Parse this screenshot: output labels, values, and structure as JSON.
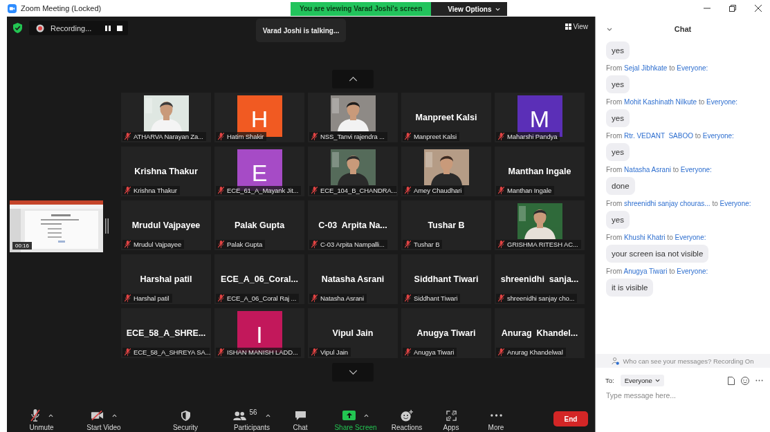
{
  "window": {
    "title": "Zoom Meeting (Locked)"
  },
  "banner": {
    "text": "You are viewing Varad Joshi's screen",
    "menu": "View Options"
  },
  "recording": {
    "label": "Recording..."
  },
  "talking": "Varad Joshi is talking...",
  "view_button": "View",
  "thumbnail": {
    "timer": "00:16"
  },
  "tiles": [
    {
      "label": "ATHARVA Narayan Za...",
      "muted": true
    },
    {
      "kind": "avatar",
      "letter": "H",
      "color": "#f15a22",
      "label": "Hatim Shakir",
      "muted": true
    },
    {
      "label": "NSS_Tanvi rajendra ...",
      "muted": true
    },
    {
      "kind": "name",
      "name": "Manpreet Kalsi",
      "label": "Manpreet Kalsi",
      "muted": true
    },
    {
      "kind": "avatar",
      "letter": "M",
      "color": "#5b2fb7",
      "label": "Maharshi Pandya",
      "muted": true
    },
    {
      "kind": "name",
      "name": "Krishna Thakur",
      "label": "Krishna Thakur",
      "muted": true
    },
    {
      "kind": "avatar",
      "letter": "E",
      "color": "#a64bc6",
      "label": "ECE_61_A_Mayank Jit...",
      "muted": true
    },
    {
      "label": "ECE_104_B_CHANDRA...",
      "muted": true
    },
    {
      "label": "Amey Chaudhari",
      "muted": true
    },
    {
      "kind": "name",
      "name": "Manthan Ingale",
      "label": "Manthan Ingale",
      "muted": true
    },
    {
      "kind": "name",
      "name": "Mrudul Vajpayee",
      "label": "Mrudul Vajpayee",
      "muted": true
    },
    {
      "kind": "name",
      "name": "Palak Gupta",
      "label": "Palak Gupta",
      "muted": true
    },
    {
      "kind": "name",
      "name": "C-03  Arpita Na...",
      "label": "C-03 Arpita Nampalli...",
      "muted": true
    },
    {
      "kind": "name",
      "name": "Tushar B",
      "label": "Tushar B",
      "muted": true
    },
    {
      "label": "GRISHMA RITESH AC...",
      "muted": true
    },
    {
      "kind": "name",
      "name": "Harshal patil",
      "label": "Harshal patil",
      "muted": true
    },
    {
      "kind": "name",
      "name": "ECE_A_06_Coral...",
      "label": "ECE_A_06_Coral Raj ...",
      "muted": true
    },
    {
      "kind": "name",
      "name": "Natasha Asrani",
      "label": "Natasha Asrani",
      "muted": true
    },
    {
      "kind": "name",
      "name": "Siddhant Tiwari",
      "label": "Siddhant Tiwari",
      "muted": true
    },
    {
      "kind": "name",
      "name": "shreenidhi  sanja...",
      "label": "shreenidhi sanjay cho...",
      "muted": true
    },
    {
      "kind": "name",
      "name": "ECE_58_A_SHRE...",
      "label": "ECE_58_A_SHREYA SA...",
      "muted": true
    },
    {
      "kind": "avatar",
      "letter": "I",
      "color": "#c2185b",
      "label": "ISHAN MANISH LADD...",
      "muted": true
    },
    {
      "kind": "name",
      "name": "Vipul Jain",
      "label": "Vipul Jain",
      "muted": true
    },
    {
      "kind": "name",
      "name": "Anugya Tiwari",
      "label": "Anugya Tiwari",
      "muted": true
    },
    {
      "kind": "name",
      "name": "Anurag  Khandel...",
      "label": "Anurag Khandelwal",
      "muted": true
    }
  ],
  "toolbar": [
    {
      "kind": "mic-off",
      "label": "Unmute",
      "caret": true
    },
    {
      "kind": "video-off",
      "label": "Start Video",
      "caret": true
    },
    {
      "kind": "security",
      "label": "Security",
      "caret": false
    },
    {
      "kind": "participants",
      "label": "Participants",
      "count": "56",
      "caret": true
    },
    {
      "kind": "chat",
      "label": "Chat",
      "caret": false
    },
    {
      "kind": "share",
      "label": "Share Screen",
      "caret": true
    },
    {
      "kind": "reactions",
      "label": "Reactions",
      "caret": false
    },
    {
      "kind": "apps",
      "label": "Apps",
      "caret": false
    },
    {
      "kind": "more",
      "label": "More",
      "caret": false
    }
  ],
  "end_button": "End",
  "chat": {
    "title": "Chat",
    "messages": [
      {
        "text": "yes"
      },
      {
        "from": "From",
        "sender": "Sejal Jibhkate",
        "to": "to",
        "recipient": "Everyone:",
        "text": "yes"
      },
      {
        "from": "From",
        "sender": "Mohit Kashinath Nilkute",
        "to": "to",
        "recipient": "Everyone:",
        "text": "yes"
      },
      {
        "from": "From",
        "sender": "Rtr. VEDANT  SABOO",
        "to": "to",
        "recipient": "Everyone:",
        "text": "yes"
      },
      {
        "from": "From",
        "sender": "Natasha Asrani",
        "to": "to",
        "recipient": "Everyone:",
        "text": "done"
      },
      {
        "from": "From",
        "sender": "shreenidhi sanjay chouras...",
        "to": "to",
        "recipient": "Everyone:",
        "text": "yes"
      },
      {
        "from": "From",
        "sender": "Khushi Khatri",
        "to": "to",
        "recipient": "Everyone:",
        "text": "your screen isa not visible"
      },
      {
        "from": "From",
        "sender": "Anugya Tiwari",
        "to": "to",
        "recipient": "Everyone:",
        "text": "it is visible"
      }
    ],
    "notice": "Who can see your messages? Recording On",
    "to_label": "To:",
    "recipient": "Everyone",
    "input": {
      "placeholder": "Type message here..."
    }
  }
}
